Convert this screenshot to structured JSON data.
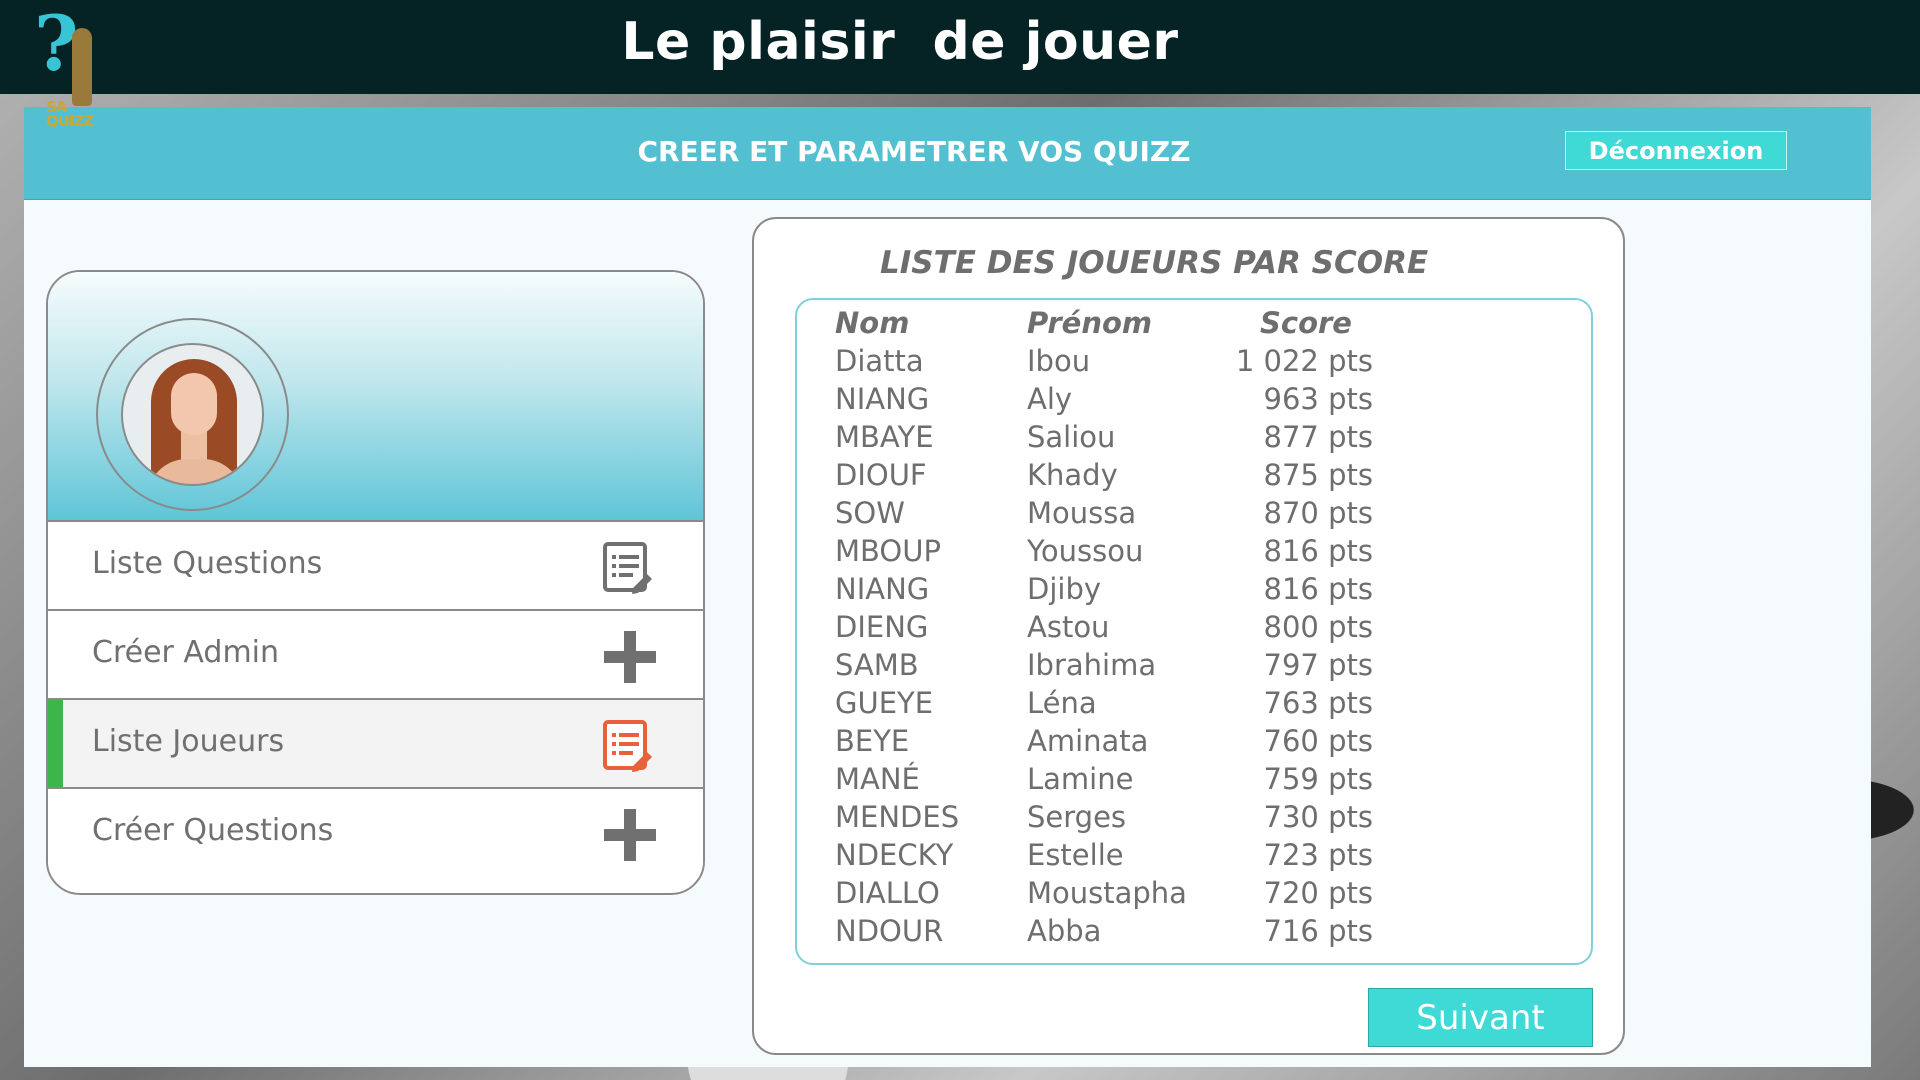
{
  "app": {
    "title": "Le plaisir  de jouer",
    "logo_text": "SA QUIZZ"
  },
  "header": {
    "subtitle": "CREER ET PARAMETRER VOS QUIZZ",
    "logout_label": "Déconnexion"
  },
  "menu": {
    "items": [
      {
        "label": "Liste Questions",
        "icon": "list-edit-icon",
        "active": false
      },
      {
        "label": "Créer Admin",
        "icon": "plus-icon",
        "active": false
      },
      {
        "label": "Liste Joueurs",
        "icon": "list-edit-icon",
        "active": true
      },
      {
        "label": "Créer Questions",
        "icon": "plus-icon",
        "active": false
      }
    ]
  },
  "scores": {
    "title": "LISTE DES JOUEURS PAR SCORE",
    "headers": {
      "nom": "Nom",
      "prenom": "Prénom",
      "score": "Score"
    },
    "rows": [
      {
        "nom": "Diatta",
        "prenom": "Ibou",
        "score": "1 022 pts"
      },
      {
        "nom": "NIANG",
        "prenom": "Aly",
        "score": "963 pts"
      },
      {
        "nom": "MBAYE",
        "prenom": "Saliou",
        "score": "877 pts"
      },
      {
        "nom": "DIOUF",
        "prenom": "Khady",
        "score": "875 pts"
      },
      {
        "nom": "SOW",
        "prenom": "Moussa",
        "score": "870 pts"
      },
      {
        "nom": "MBOUP",
        "prenom": "Youssou",
        "score": "816 pts"
      },
      {
        "nom": "NIANG",
        "prenom": "Djiby",
        "score": "816 pts"
      },
      {
        "nom": "DIENG",
        "prenom": "Astou",
        "score": "800 pts"
      },
      {
        "nom": "SAMB",
        "prenom": "Ibrahima",
        "score": "797 pts"
      },
      {
        "nom": "GUEYE",
        "prenom": "Léna",
        "score": "763 pts"
      },
      {
        "nom": "BEYE",
        "prenom": "Aminata",
        "score": "760 pts"
      },
      {
        "nom": "MANÉ",
        "prenom": "Lamine",
        "score": "759 pts"
      },
      {
        "nom": "MENDES",
        "prenom": "Serges",
        "score": "730 pts"
      },
      {
        "nom": "NDECKY",
        "prenom": "Estelle",
        "score": "723 pts"
      },
      {
        "nom": "DIALLO",
        "prenom": "Moustapha",
        "score": "720 pts"
      },
      {
        "nom": "NDOUR",
        "prenom": "Abba",
        "score": "716 pts"
      }
    ],
    "next_label": "Suivant"
  },
  "colors": {
    "topbar": "#052325",
    "header": "#53c0d2",
    "button": "#3fdad6",
    "active_accent": "#3cb54a",
    "active_icon": "#e8603c"
  }
}
